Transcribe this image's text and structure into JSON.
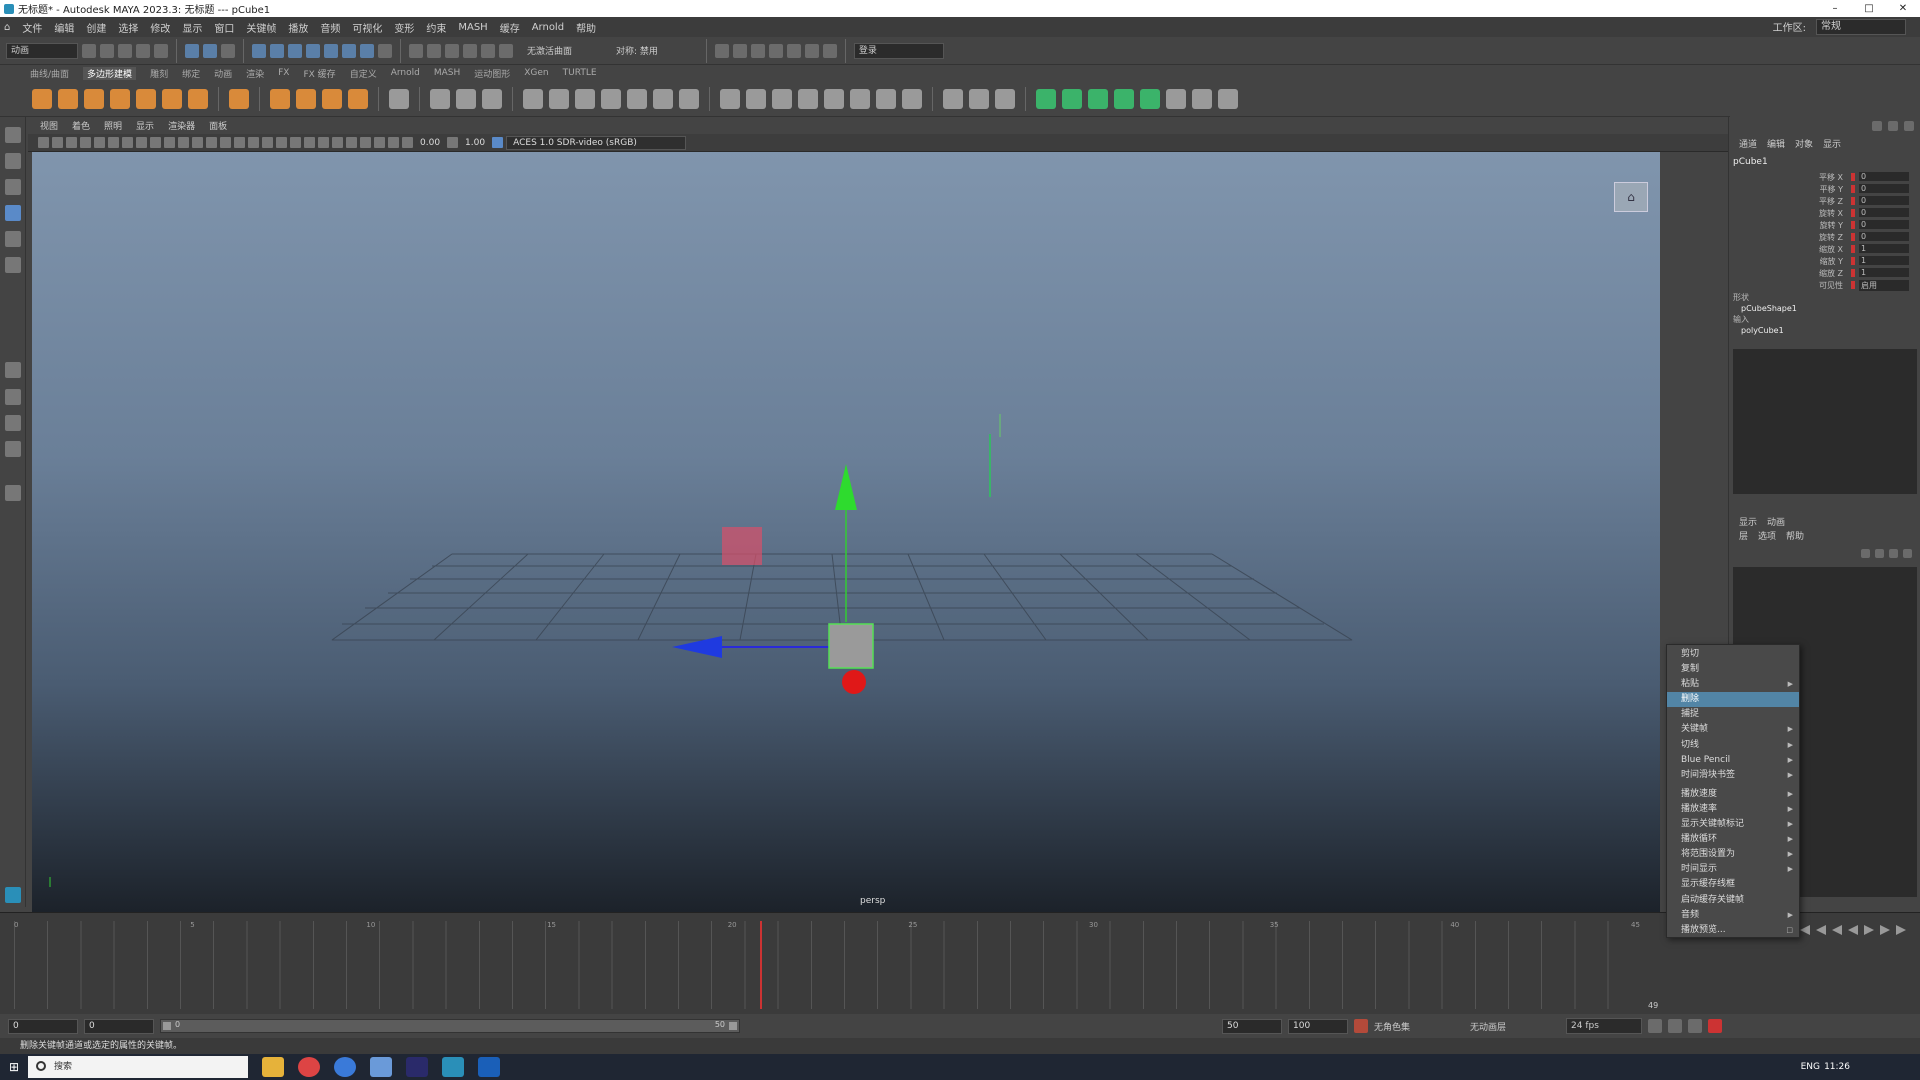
{
  "window": {
    "title": "无标题* - Autodesk MAYA 2023.3: 无标题   ---   pCube1",
    "controls": [
      "–",
      "□",
      "✕"
    ]
  },
  "menubar": {
    "items": [
      "文件",
      "编辑",
      "创建",
      "选择",
      "修改",
      "显示",
      "窗口",
      "关键帧",
      "播放",
      "音频",
      "可视化",
      "变形",
      "约束",
      "MASH",
      "缓存",
      "Arnold",
      "帮助"
    ],
    "workspace_label": "工作区:",
    "workspace_value": "常规"
  },
  "statusline": {
    "mode": "动画",
    "live_surface": "无激活曲面",
    "symmetry": "对称: 禁用",
    "login": "登录"
  },
  "shelf": {
    "tabs": [
      "曲线/曲面",
      "多边形建模",
      "雕刻",
      "绑定",
      "动画",
      "渲染",
      "FX",
      "FX 缓存",
      "自定义",
      "Arnold",
      "MASH",
      "运动图形",
      "XGen",
      "TURTLE"
    ],
    "active_tab": "多边形建模"
  },
  "viewport": {
    "menu": [
      "视图",
      "着色",
      "照明",
      "显示",
      "渲染器",
      "面板"
    ],
    "exposure": "0.00",
    "gamma": "1.00",
    "color_space": "ACES 1.0 SDR-video (sRGB)",
    "camera": "persp"
  },
  "channelbox": {
    "tabs": [
      "通道",
      "编辑",
      "对象",
      "显示"
    ],
    "object": "pCube1",
    "attributes": [
      {
        "name": "平移 X",
        "value": "0"
      },
      {
        "name": "平移 Y",
        "value": "0"
      },
      {
        "name": "平移 Z",
        "value": "0"
      },
      {
        "name": "旋转 X",
        "value": "0"
      },
      {
        "name": "旋转 Y",
        "value": "0"
      },
      {
        "name": "旋转 Z",
        "value": "0"
      },
      {
        "name": "缩放 X",
        "value": "1"
      },
      {
        "name": "缩放 Y",
        "value": "1"
      },
      {
        "name": "缩放 Z",
        "value": "1"
      },
      {
        "name": "可见性",
        "value": "启用"
      }
    ],
    "shapes_label": "形状",
    "shape_node": "pCubeShape1",
    "inputs_label": "输入",
    "input_node": "polyCube1",
    "layer_tabs": [
      "显示",
      "动画"
    ],
    "layer_menu": [
      "层",
      "选项",
      "帮助"
    ]
  },
  "timeline": {
    "tick_labels": [
      "0",
      "5",
      "10",
      "15",
      "20",
      "25",
      "30",
      "35",
      "40",
      "45"
    ],
    "current_frame": "49"
  },
  "rangebar": {
    "start": "0",
    "inner_start": "0",
    "inner_end": "50",
    "playback_label": "0",
    "anim_end": "100",
    "character_set": "无角色集",
    "anim_layer": "无动画层",
    "fps": "24 fps"
  },
  "helpline": {
    "text": "删除关键帧通道或选定的属性的关键帧。"
  },
  "taskbar": {
    "search_placeholder": "搜索",
    "lang": "ENG",
    "time": "11:26"
  },
  "context_menu": {
    "items": [
      {
        "label": "剪切",
        "submenu": false
      },
      {
        "label": "复制",
        "submenu": false
      },
      {
        "label": "粘贴",
        "submenu": true
      },
      {
        "label": "删除",
        "submenu": false,
        "highlighted": true
      },
      {
        "label": "捕捉",
        "submenu": false
      },
      {
        "label": "关键帧",
        "submenu": true
      },
      {
        "label": "切线",
        "submenu": true
      },
      {
        "label": "Blue Pencil",
        "submenu": true
      },
      {
        "label": "时间滑块书签",
        "submenu": true
      },
      {
        "label": "播放速度",
        "submenu": true
      },
      {
        "label": "播放速率",
        "submenu": true
      },
      {
        "label": "显示关键帧标记",
        "submenu": true
      },
      {
        "label": "播放循环",
        "submenu": true
      },
      {
        "label": "将范围设置为",
        "submenu": true
      },
      {
        "label": "时间显示",
        "submenu": true
      },
      {
        "label": "显示缓存线框",
        "submenu": false
      },
      {
        "label": "启动缓存关键帧",
        "submenu": false
      },
      {
        "label": "音频",
        "submenu": true
      },
      {
        "label": "播放预览...",
        "submenu": false
      }
    ]
  },
  "colors": {
    "accent": "#5285a6",
    "playhead": "#cc3333",
    "shelf_orange": "#d98a3a"
  }
}
